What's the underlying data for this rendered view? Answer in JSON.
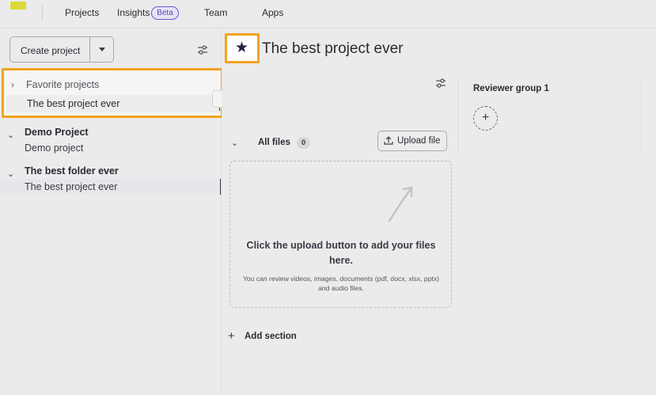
{
  "nav": {
    "tabs": [
      {
        "label": "Projects"
      },
      {
        "label": "Insights"
      },
      {
        "label": "Team"
      },
      {
        "label": "Apps"
      }
    ],
    "beta_badge": "Beta"
  },
  "sidebar": {
    "create_label": "Create project",
    "favorites": {
      "header": "Favorite projects",
      "items": [
        "The best project ever"
      ]
    },
    "groups": [
      {
        "name": "Demo Project",
        "items": [
          "Demo project"
        ]
      },
      {
        "name": "The best folder ever",
        "items": [
          "The best project ever"
        ]
      }
    ]
  },
  "main": {
    "title": "The best project ever",
    "reviewer_group": "Reviewer group 1",
    "section": {
      "name": "All files",
      "count": "0"
    },
    "upload_label": "Upload file",
    "dropzone": {
      "primary": "Click the upload button to add your files here.",
      "secondary": "You can review videos, images, documents (pdf, docx, xlsx, pptx) and audio files."
    },
    "add_section_label": "Add section"
  },
  "colors": {
    "highlight": "#f3a21f",
    "beta_accent": "#6e56cf"
  }
}
